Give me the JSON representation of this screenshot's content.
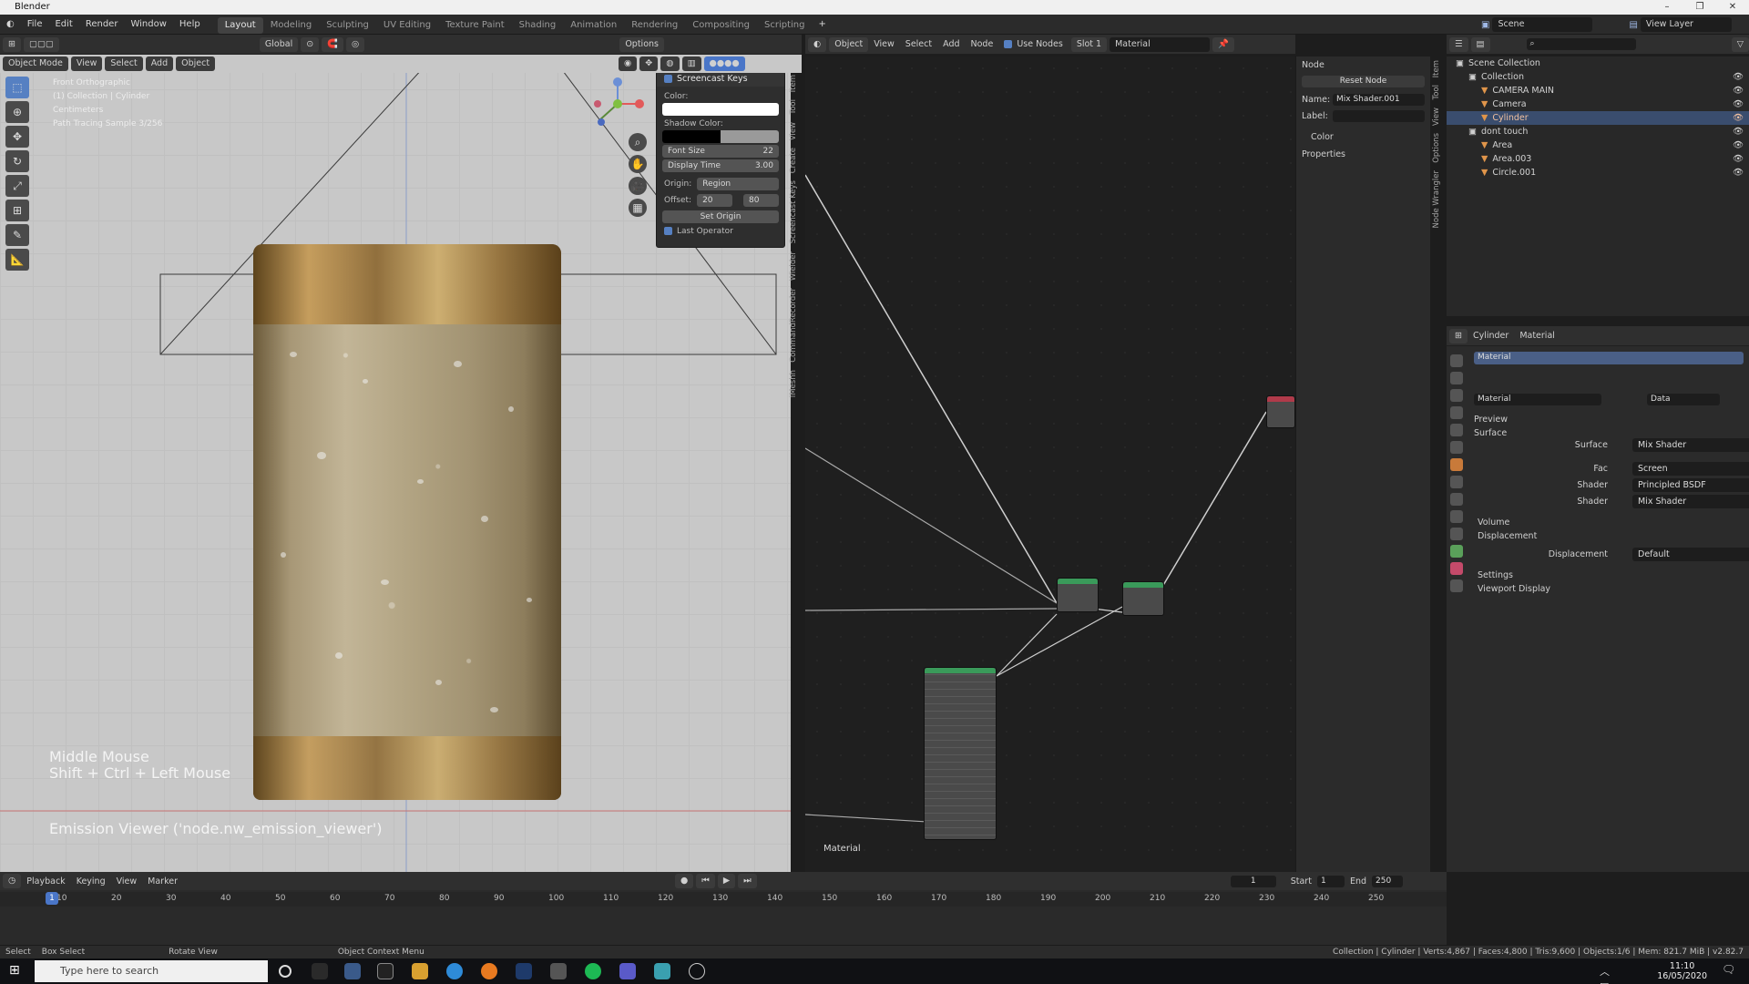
{
  "title_bar": {
    "app_title": "Blender",
    "min": "–",
    "max": "❐",
    "close": "✕"
  },
  "menus": [
    "File",
    "Edit",
    "Render",
    "Window",
    "Help"
  ],
  "workspaces": [
    {
      "label": "Layout",
      "active": true
    },
    {
      "label": "Modeling",
      "active": false
    },
    {
      "label": "Sculpting",
      "active": false
    },
    {
      "label": "UV Editing",
      "active": false
    },
    {
      "label": "Texture Paint",
      "active": false
    },
    {
      "label": "Shading",
      "active": false
    },
    {
      "label": "Animation",
      "active": false
    },
    {
      "label": "Rendering",
      "active": false
    },
    {
      "label": "Compositing",
      "active": false
    },
    {
      "label": "Scripting",
      "active": false
    }
  ],
  "scene": {
    "scene_label": "Scene",
    "view_layer_label": "View Layer"
  },
  "viewport": {
    "header": {
      "global": "Global",
      "options": "Options"
    },
    "mode": "Object Mode",
    "menus": [
      "View",
      "Select",
      "Add",
      "Object"
    ],
    "info": [
      "Front Orthographic",
      "(1) Collection | Cylinder",
      "Centimeters",
      "Path Tracing Sample 3/256"
    ],
    "keys_line1": "Middle Mouse",
    "keys_line2": "Shift + Ctrl + Left Mouse",
    "emission_text": "Emission Viewer ('node.nw_emission_viewer')",
    "side_tabs": [
      "Item",
      "Tool",
      "View",
      "Create",
      "Screencast Keys",
      "Wielder",
      "CommandRecorder",
      "iMeshh"
    ]
  },
  "screencast_panel": {
    "title": "Screencast Keys",
    "color_label": "Color:",
    "shadow_color_label": "Shadow Color:",
    "font_size_label": "Font Size",
    "font_size_value": "22",
    "display_time_label": "Display Time",
    "display_time_value": "3.00",
    "origin_label": "Origin:",
    "origin_value": "Region",
    "offset_label": "Offset:",
    "offset_x": "20",
    "offset_y": "80",
    "set_origin": "Set Origin",
    "last_operator": "Last Operator"
  },
  "node_editor": {
    "header": {
      "object": "Object",
      "menus": [
        "View",
        "Select",
        "Add",
        "Node"
      ],
      "use_nodes": "Use Nodes",
      "slot": "Slot 1",
      "material": "Material"
    },
    "label": "Material"
  },
  "node_panel": {
    "title": "Node",
    "reset_node": "Reset Node",
    "name_label": "Name:",
    "name_value": "Mix Shader.001",
    "label_label": "Label:",
    "color": "Color",
    "properties": "Properties",
    "side_tabs": [
      "Item",
      "Tool",
      "View",
      "Options",
      "Node Wrangler"
    ]
  },
  "outliner": {
    "rows": [
      {
        "label": "Scene Collection",
        "indent": 0,
        "selected": false
      },
      {
        "label": "Collection",
        "indent": 1,
        "selected": false
      },
      {
        "label": "CAMERA MAIN",
        "indent": 2,
        "selected": false
      },
      {
        "label": "Camera",
        "indent": 2,
        "selected": false
      },
      {
        "label": "Cylinder",
        "indent": 2,
        "selected": true
      },
      {
        "label": "dont touch",
        "indent": 1,
        "selected": false
      },
      {
        "label": "Area",
        "indent": 2,
        "selected": false
      },
      {
        "label": "Area.003",
        "indent": 2,
        "selected": false
      },
      {
        "label": "Circle.001",
        "indent": 2,
        "selected": false
      }
    ]
  },
  "properties": {
    "breadcrumb_object": "Cylinder",
    "breadcrumb_material": "Material",
    "slot_name": "Material",
    "material_field": "Material",
    "data_label": "Data",
    "preview": "Preview",
    "surface": "Surface",
    "rows": [
      {
        "label": "Surface",
        "value": "Mix Shader"
      },
      {
        "label": "Fac",
        "value": "Screen"
      },
      {
        "label": "Shader",
        "value": "Principled BSDF"
      },
      {
        "label": "Shader",
        "value": "Mix Shader"
      }
    ],
    "volume": "Volume",
    "displacement": "Displacement",
    "displacement_label": "Displacement",
    "displacement_value": "Default",
    "settings": "Settings",
    "viewport_display": "Viewport Display"
  },
  "timeline": {
    "menus": [
      "Playback",
      "Keying",
      "View",
      "Marker"
    ],
    "current_frame": "1",
    "start_label": "Start",
    "start_value": "1",
    "end_label": "End",
    "end_value": "250",
    "ticks": [
      "10",
      "20",
      "30",
      "40",
      "50",
      "60",
      "70",
      "80",
      "90",
      "100",
      "110",
      "120",
      "130",
      "140",
      "150",
      "160",
      "170",
      "180",
      "190",
      "200",
      "210",
      "220",
      "230",
      "240",
      "250"
    ],
    "playhead": "1"
  },
  "statusbar": {
    "select": "Select",
    "box_select": "Box Select",
    "rotate_view": "Rotate View",
    "context_menu": "Object Context Menu",
    "stats": "Collection | Cylinder | Verts:4,867 | Faces:4,800 | Tris:9,600 | Objects:1/6 | Mem: 821.7 MiB | v2.82.7"
  },
  "taskbar": {
    "search_placeholder": "Type here to search",
    "time": "11:10",
    "date": "16/05/2020"
  }
}
